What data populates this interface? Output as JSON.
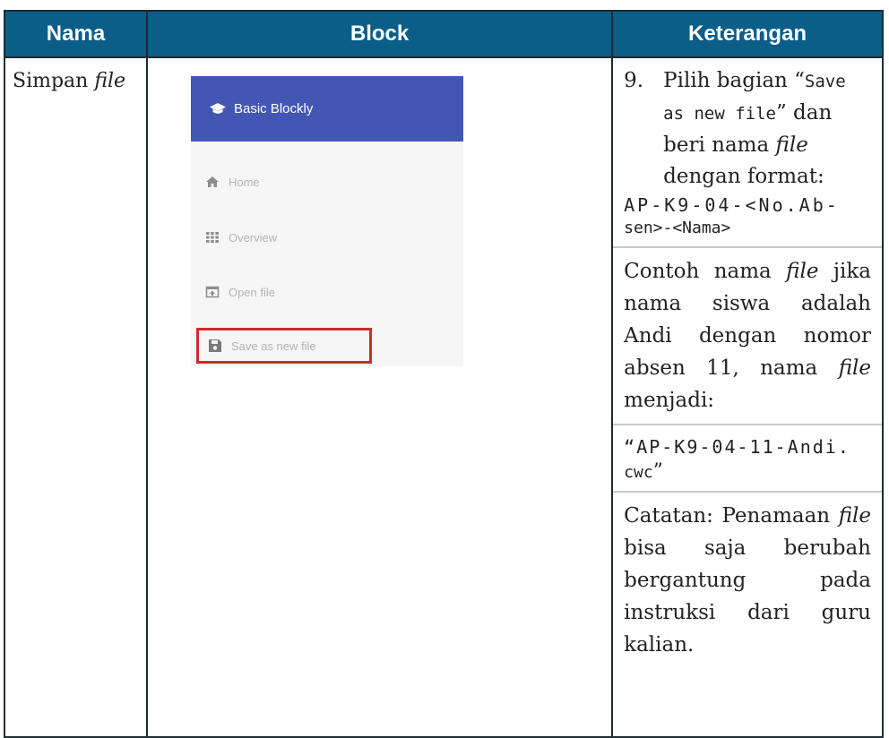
{
  "headers": {
    "nama": "Nama",
    "block": "Block",
    "keterangan": "Keterangan"
  },
  "row": {
    "nama": {
      "text": "Simpan",
      "italic": "file"
    },
    "block": {
      "app_title": "Basic Blockly",
      "menu": [
        "Home",
        "Overview",
        "Open file",
        "Save as new file"
      ],
      "highlighted_item": "Save as new file",
      "highlight_color": "#d22a2a",
      "header_color": "#4356b3"
    },
    "keterangan": {
      "step_number": "9.",
      "step_text_1": "Pilih bagian “",
      "step_code": "Save as new file",
      "step_text_2": "” dan beri nama ",
      "step_italic": "file",
      "step_text_3": " dengan format:",
      "format_code_1": "AP-K9-04-<No.Ab-",
      "format_code_2": "sen>-<Nama>",
      "example_text_1": "Contoh nama ",
      "example_italic_1": "file",
      "example_text_2": " jika nama siswa adalah Andi dengan nomor absen 11,  nama ",
      "example_italic_2": "file",
      "example_text_3": " menjadi:",
      "example_open_quote": "“",
      "example_code_1": "AP-K9-04-11-Andi.",
      "example_code_2": "cwc",
      "example_close_quote": "”",
      "note_text_1": "Catatan: Penamaan ",
      "note_italic": "file",
      "note_text_2": " bisa saja berubah bergantung pada instruksi dari guru kalian."
    }
  }
}
